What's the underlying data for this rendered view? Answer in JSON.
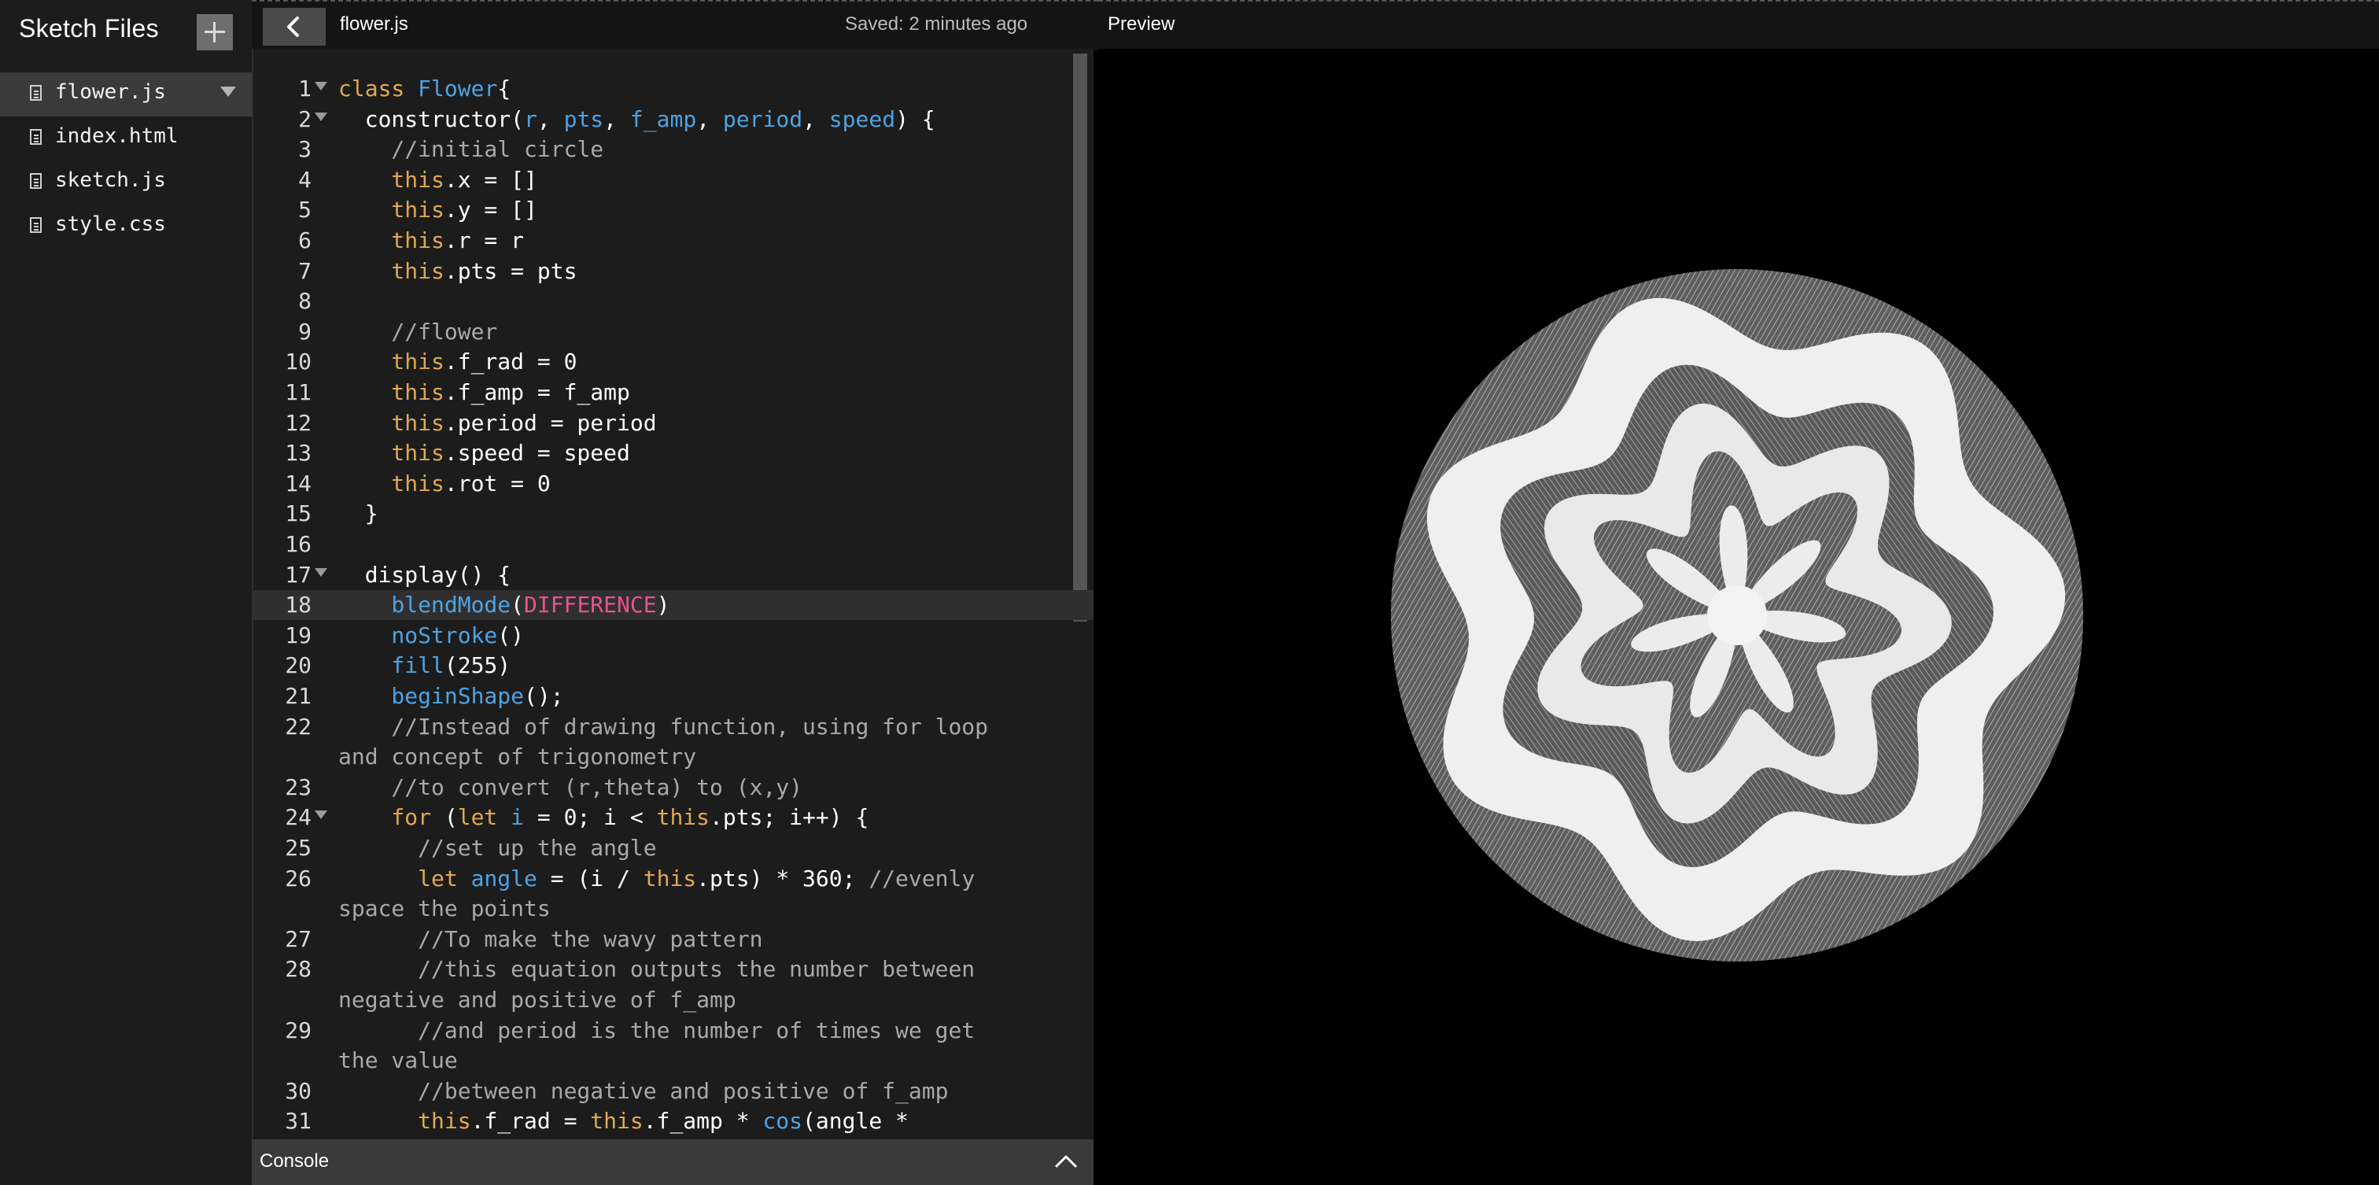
{
  "sidebar": {
    "title": "Sketch Files",
    "files": [
      {
        "name": "flower.js",
        "active": true
      },
      {
        "name": "index.html",
        "active": false
      },
      {
        "name": "sketch.js",
        "active": false
      },
      {
        "name": "style.css",
        "active": false
      }
    ]
  },
  "editor_header": {
    "tab_name": "flower.js",
    "saved": "Saved: 2 minutes ago"
  },
  "preview": {
    "label": "Preview"
  },
  "console": {
    "label": "Console"
  },
  "editor": {
    "active_line": 18,
    "lines": [
      {
        "num": "1",
        "fold": true,
        "tokens": [
          [
            "kw",
            "class "
          ],
          [
            "fn",
            "Flower"
          ],
          [
            "",
            "{"
          ]
        ]
      },
      {
        "num": "2",
        "fold": true,
        "tokens": [
          [
            "",
            "  constructor("
          ],
          [
            "fn",
            "r"
          ],
          [
            "",
            ", "
          ],
          [
            "fn",
            "pts"
          ],
          [
            "",
            ", "
          ],
          [
            "fn",
            "f_amp"
          ],
          [
            "",
            ", "
          ],
          [
            "fn",
            "period"
          ],
          [
            "",
            ", "
          ],
          [
            "fn",
            "speed"
          ],
          [
            "",
            ") {"
          ]
        ]
      },
      {
        "num": "3",
        "tokens": [
          [
            "cm",
            "    //initial circle"
          ]
        ]
      },
      {
        "num": "4",
        "tokens": [
          [
            "kw",
            "    this"
          ],
          [
            "",
            ".x = []"
          ]
        ]
      },
      {
        "num": "5",
        "tokens": [
          [
            "kw",
            "    this"
          ],
          [
            "",
            ".y = []"
          ]
        ]
      },
      {
        "num": "6",
        "tokens": [
          [
            "kw",
            "    this"
          ],
          [
            "",
            ".r = r"
          ]
        ]
      },
      {
        "num": "7",
        "tokens": [
          [
            "kw",
            "    this"
          ],
          [
            "",
            ".pts = pts"
          ]
        ]
      },
      {
        "num": "8",
        "tokens": [
          [
            "",
            ""
          ]
        ]
      },
      {
        "num": "9",
        "tokens": [
          [
            "cm",
            "    //flower"
          ]
        ]
      },
      {
        "num": "10",
        "tokens": [
          [
            "kw",
            "    this"
          ],
          [
            "",
            ".f_rad = 0"
          ]
        ]
      },
      {
        "num": "11",
        "tokens": [
          [
            "kw",
            "    this"
          ],
          [
            "",
            ".f_amp = f_amp"
          ]
        ]
      },
      {
        "num": "12",
        "tokens": [
          [
            "kw",
            "    this"
          ],
          [
            "",
            ".period = period"
          ]
        ]
      },
      {
        "num": "13",
        "tokens": [
          [
            "kw",
            "    this"
          ],
          [
            "",
            ".speed = speed"
          ]
        ]
      },
      {
        "num": "14",
        "tokens": [
          [
            "kw",
            "    this"
          ],
          [
            "",
            ".rot = 0"
          ]
        ]
      },
      {
        "num": "15",
        "tokens": [
          [
            "",
            "  }"
          ]
        ]
      },
      {
        "num": "16",
        "tokens": [
          [
            "",
            ""
          ]
        ]
      },
      {
        "num": "17",
        "fold": true,
        "tokens": [
          [
            "",
            "  display() {"
          ]
        ]
      },
      {
        "num": "18",
        "tokens": [
          [
            "fn",
            "    blendMode"
          ],
          [
            "",
            "("
          ],
          [
            "const",
            "DIFFERENCE"
          ],
          [
            "",
            ")"
          ]
        ]
      },
      {
        "num": "19",
        "tokens": [
          [
            "fn",
            "    noStroke"
          ],
          [
            "",
            "()"
          ]
        ]
      },
      {
        "num": "20",
        "tokens": [
          [
            "fn",
            "    fill"
          ],
          [
            "",
            "(255)"
          ]
        ]
      },
      {
        "num": "21",
        "tokens": [
          [
            "fn",
            "    beginShape"
          ],
          [
            "",
            "();"
          ]
        ]
      },
      {
        "num": "22",
        "tokens": [
          [
            "cm",
            "    //Instead of drawing function, using for loop"
          ]
        ]
      },
      {
        "num": "",
        "tokens": [
          [
            "cm",
            "and concept of trigonometry"
          ]
        ]
      },
      {
        "num": "23",
        "tokens": [
          [
            "cm",
            "    //to convert (r,theta) to (x,y)"
          ]
        ]
      },
      {
        "num": "24",
        "fold": true,
        "tokens": [
          [
            "kw",
            "    for "
          ],
          [
            "",
            "("
          ],
          [
            "kw",
            "let "
          ],
          [
            "fn",
            "i"
          ],
          [
            "",
            " = 0; i < "
          ],
          [
            "kw",
            "this"
          ],
          [
            "",
            ".pts; i++) {"
          ]
        ]
      },
      {
        "num": "25",
        "tokens": [
          [
            "cm",
            "      //set up the angle"
          ]
        ]
      },
      {
        "num": "26",
        "tokens": [
          [
            "kw",
            "      let "
          ],
          [
            "fn",
            "angle"
          ],
          [
            "",
            " = (i / "
          ],
          [
            "kw",
            "this"
          ],
          [
            "",
            ".pts) * 360; "
          ],
          [
            "cm",
            "//evenly"
          ]
        ]
      },
      {
        "num": "",
        "tokens": [
          [
            "cm",
            "space the points"
          ]
        ]
      },
      {
        "num": "27",
        "tokens": [
          [
            "cm",
            "      //To make the wavy pattern"
          ]
        ]
      },
      {
        "num": "28",
        "tokens": [
          [
            "cm",
            "      //this equation outputs the number between"
          ]
        ]
      },
      {
        "num": "",
        "tokens": [
          [
            "cm",
            "negative and positive of f_amp"
          ]
        ]
      },
      {
        "num": "29",
        "tokens": [
          [
            "cm",
            "      //and period is the number of times we get"
          ]
        ]
      },
      {
        "num": "",
        "tokens": [
          [
            "cm",
            "the value"
          ]
        ]
      },
      {
        "num": "30",
        "tokens": [
          [
            "cm",
            "      //between negative and positive of f_amp"
          ]
        ]
      },
      {
        "num": "31",
        "tokens": [
          [
            "kw",
            "      this"
          ],
          [
            "",
            ".f_rad = "
          ],
          [
            "kw",
            "this"
          ],
          [
            "",
            ".f_amp * "
          ],
          [
            "fn",
            "cos"
          ],
          [
            "",
            "(angle *"
          ]
        ]
      }
    ]
  }
}
